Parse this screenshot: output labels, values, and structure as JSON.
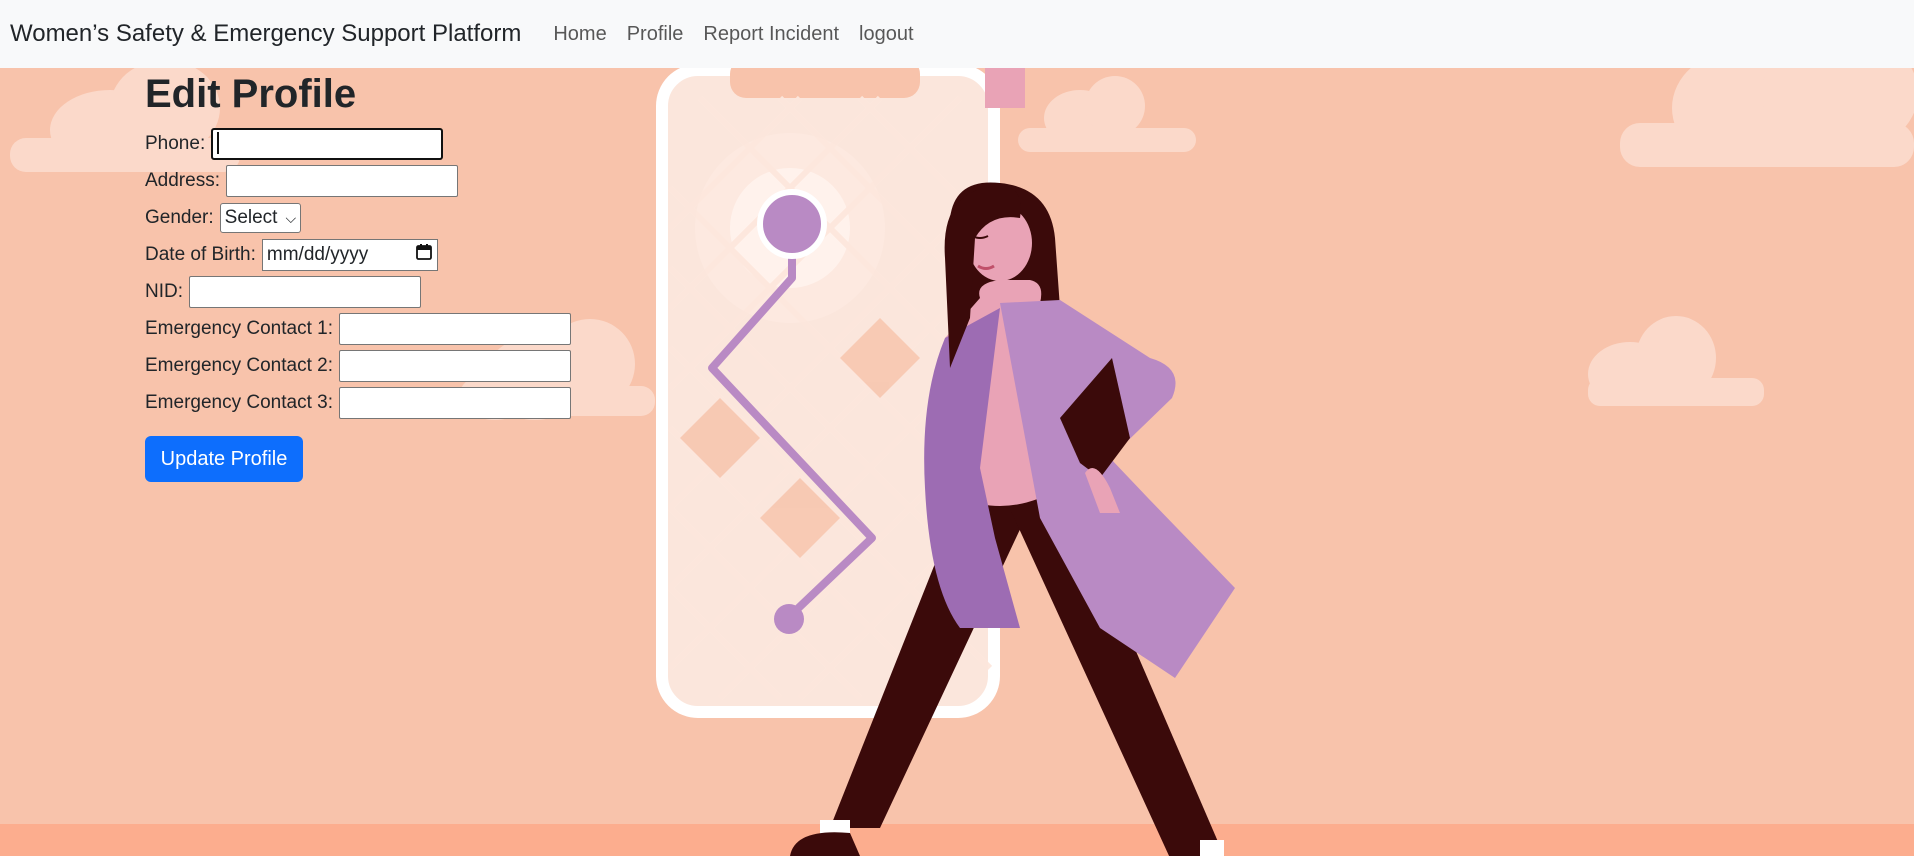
{
  "navbar": {
    "brand": "Women’s Safety & Emergency Support Platform",
    "links": [
      "Home",
      "Profile",
      "Report Incident",
      "logout"
    ]
  },
  "form": {
    "title": "Edit Profile",
    "phone_label": "Phone:",
    "phone_value": "",
    "address_label": "Address:",
    "address_value": "",
    "gender_label": "Gender:",
    "gender_selected": "Select",
    "dob_label": "Date of Birth:",
    "dob_placeholder": "mm/dd/yyyy",
    "nid_label": "NID:",
    "nid_value": "",
    "ec1_label": "Emergency Contact 1:",
    "ec2_label": "Emergency Contact 2:",
    "ec3_label": "Emergency Contact 3:",
    "submit_label": "Update Profile"
  },
  "colors": {
    "background": "#f8c3ab",
    "navbar": "#f8f9fa",
    "primary": "#0d6efd",
    "coat": "#b98ac4",
    "hair": "#3b0a0a"
  },
  "icons": [
    "calendar-icon",
    "chevron-down-icon"
  ]
}
